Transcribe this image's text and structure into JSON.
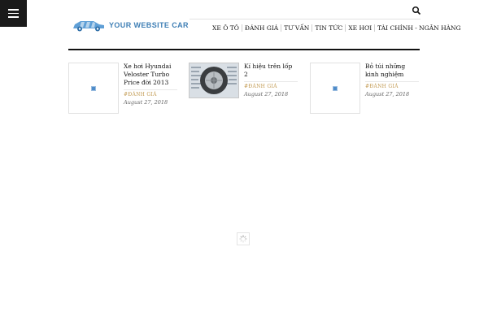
{
  "header": {
    "logo_text": "YOUR WEBSITE CAR",
    "logo_icon": "car-logo-icon",
    "menu_icon": "hamburger-icon",
    "search_icon": "search-icon",
    "accent_color": "#3f7fb5"
  },
  "nav": {
    "items": [
      {
        "label": "XE Ô TÔ"
      },
      {
        "label": "ĐÁNH GIÁ"
      },
      {
        "label": "TƯ VẤN"
      },
      {
        "label": "TIN TỨC"
      },
      {
        "label": "XE HƠI"
      },
      {
        "label": "TÀI CHÍNH - NGÂN HÀNG"
      }
    ]
  },
  "posts": [
    {
      "title": "Xe hơi Hyundai Veloster Turbo Price đời 2013",
      "category": "#ĐÁNH GIÁ",
      "date": "August 27, 2018",
      "thumb": "image-placeholder-icon"
    },
    {
      "title": "Kí hiệu trên lốp 2",
      "category": "#ĐÁNH GIÁ",
      "date": "August 27, 2018",
      "thumb": "tire-image"
    },
    {
      "title": "Bỏ túi những kinh nghiệm",
      "category": "#ĐÁNH GIÁ",
      "date": "August 27, 2018",
      "thumb": "image-placeholder-icon"
    }
  ],
  "category_color": "#c29a52",
  "loader_icon": "spinner-icon"
}
